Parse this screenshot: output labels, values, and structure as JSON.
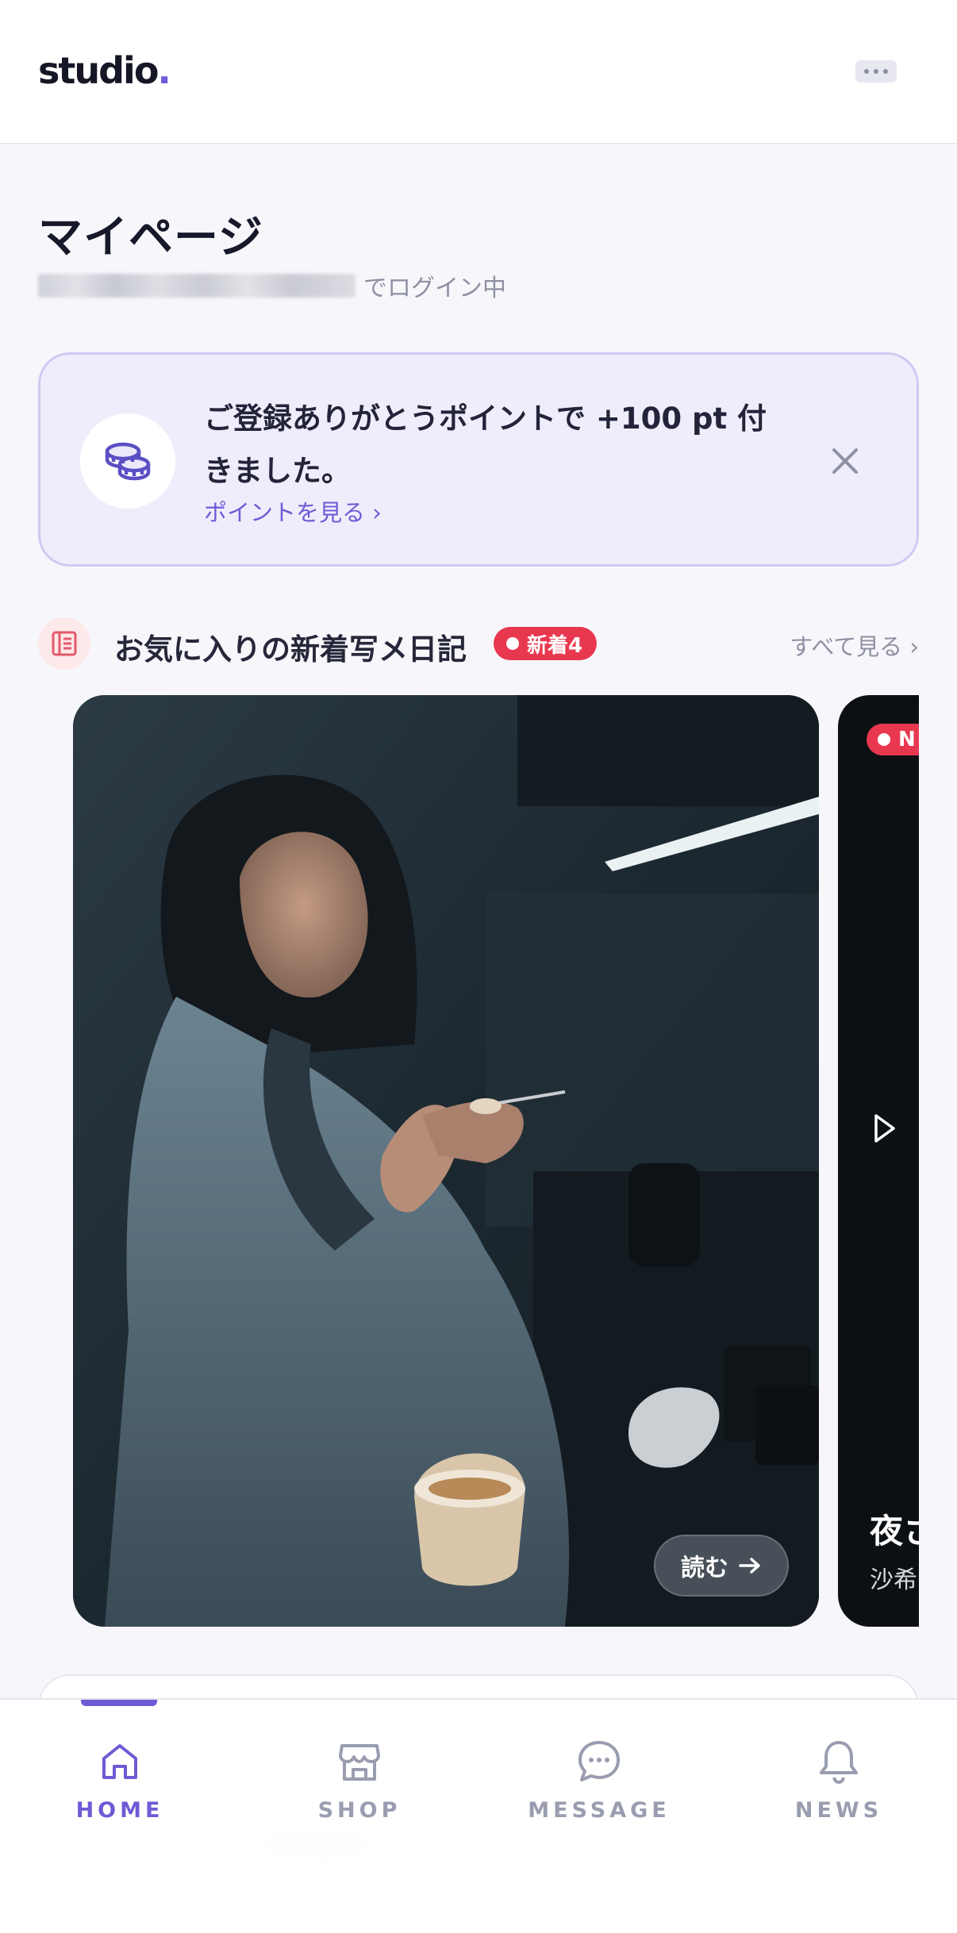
{
  "header": {
    "logo_text": "studio",
    "logo_dot": ".",
    "more_icon": "more-horizontal-icon"
  },
  "page": {
    "title": "マイページ",
    "login_suffix": "でログイン中"
  },
  "notice": {
    "icon": "coins-icon",
    "message": "ご登録ありがとうポイントで +100 pt 付きました。",
    "link": "ポイントを見る ›",
    "close_icon": "close-icon"
  },
  "diary_section": {
    "icon": "diary-icon",
    "title": "お気に入りの新着写メ日記",
    "badge": "新着4",
    "see_all": "すべて見る ›",
    "cards": [
      {
        "read_label": "読む",
        "read_icon": "arrow-right-icon"
      },
      {
        "badge": "N",
        "title": "夜さ",
        "author": "沙希",
        "play_icon": "play-icon"
      }
    ]
  },
  "tabbar": {
    "active": "HOME",
    "tabs": [
      {
        "label": "HOME",
        "icon": "home-icon"
      },
      {
        "label": "SHOP",
        "icon": "shop-icon"
      },
      {
        "label": "MESSAGE",
        "icon": "message-icon"
      },
      {
        "label": "NEWS",
        "icon": "bell-icon"
      }
    ]
  },
  "colors": {
    "accent": "#6d5bd6",
    "badge_red": "#e8384f",
    "notice_bg": "#efedfb",
    "page_bg": "#f7f7fb"
  }
}
